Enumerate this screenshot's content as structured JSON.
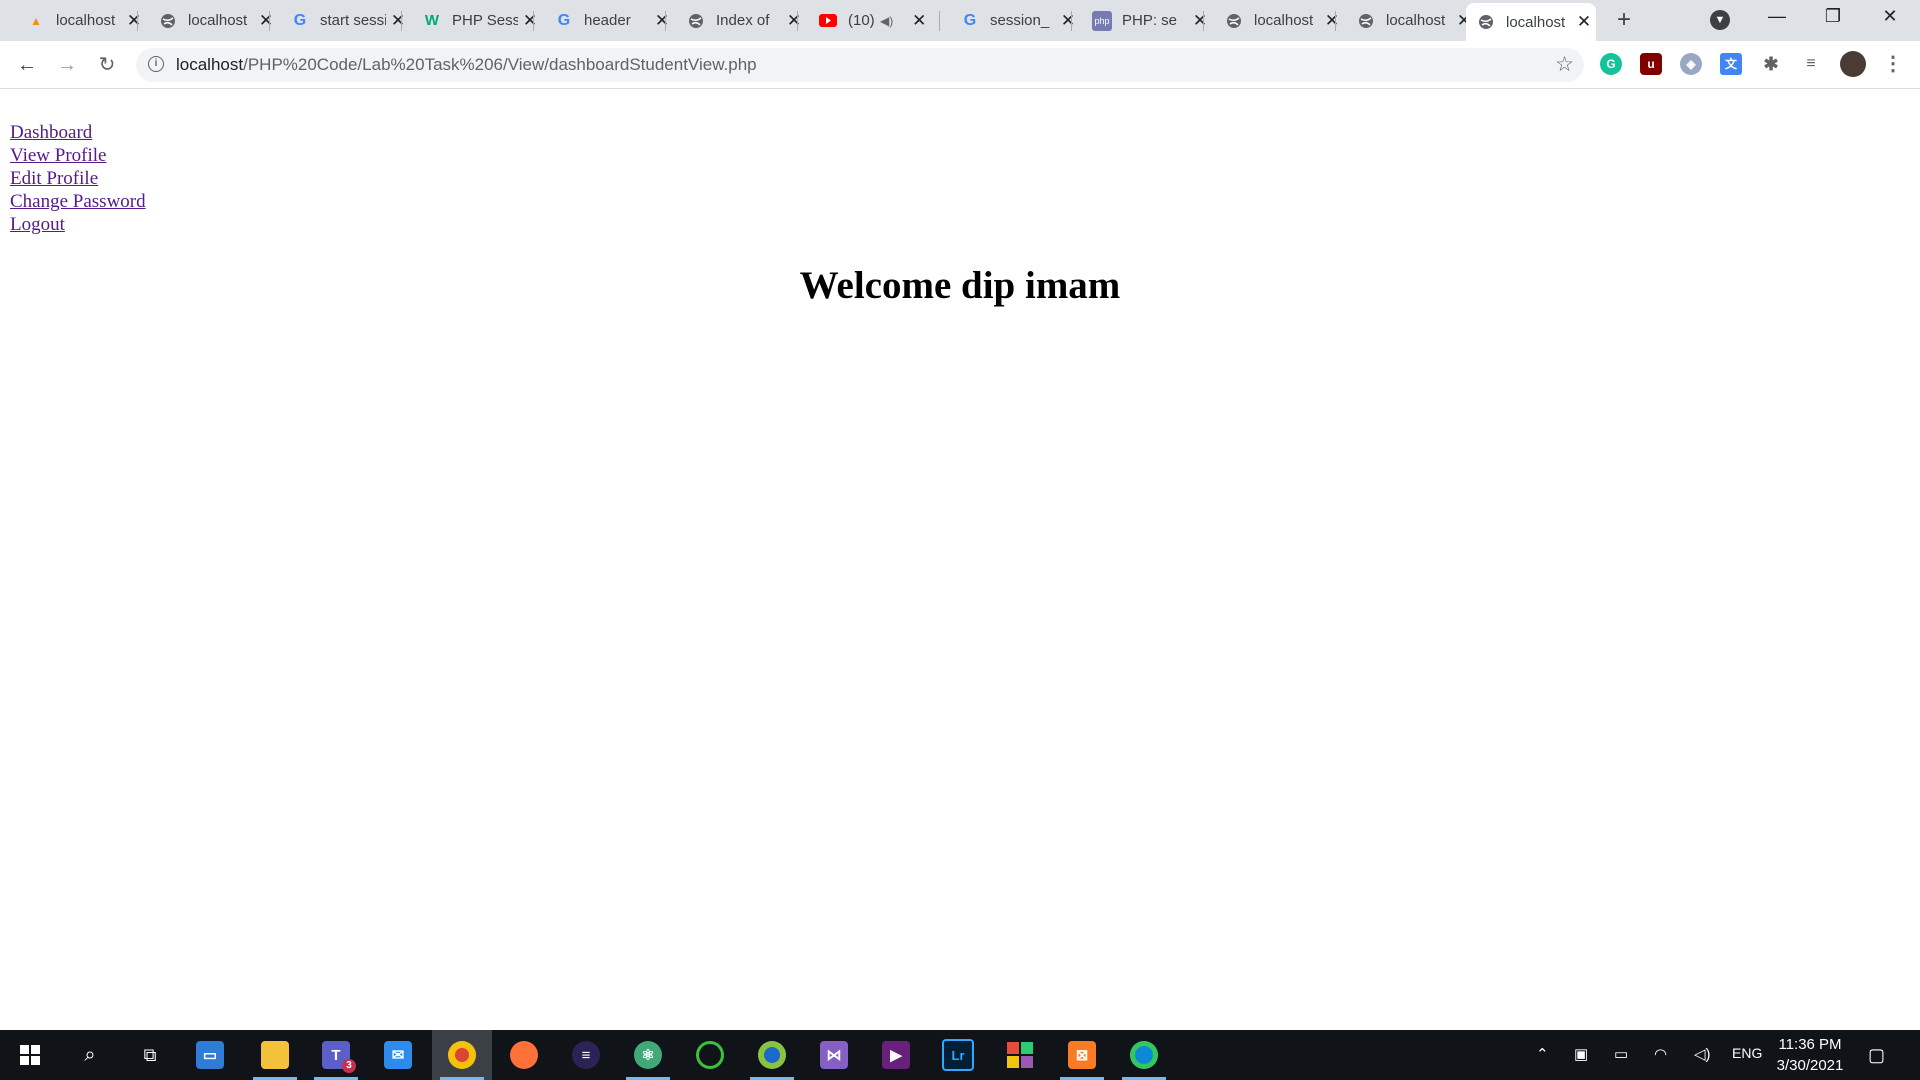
{
  "browser": {
    "tabs": [
      {
        "title": "localhost",
        "icon": "phpmyadmin-icon"
      },
      {
        "title": "localhost",
        "icon": "globe-icon"
      },
      {
        "title": "start session",
        "icon": "google-icon"
      },
      {
        "title": "PHP Session",
        "icon": "w3schools-icon"
      },
      {
        "title": "header",
        "icon": "google-icon"
      },
      {
        "title": "Index of",
        "icon": "globe-icon"
      },
      {
        "title": "(10)",
        "icon": "youtube-icon"
      },
      {
        "title": "session_",
        "icon": "google-icon"
      },
      {
        "title": "PHP: se",
        "icon": "php-icon"
      },
      {
        "title": "localhost",
        "icon": "globe-icon"
      },
      {
        "title": "localhost",
        "icon": "globe-icon"
      },
      {
        "title": "localhost",
        "icon": "globe-icon"
      }
    ],
    "url_host": "localhost",
    "url_path": "/PHP%20Code/Lab%20Task%206/View/dashboardStudentView.php"
  },
  "page": {
    "nav_links": [
      "Dashboard",
      "View Profile",
      "Edit Profile",
      "Change Password",
      "Logout"
    ],
    "welcome": "Welcome dip imam"
  },
  "taskbar": {
    "teams_badge": "3",
    "lightroom_label": "Lr",
    "language": "ENG",
    "time": "11:36 PM",
    "date": "3/30/2021"
  },
  "colors": {
    "link": "#551a8b",
    "tabstrip": "#dee1e6",
    "taskbar": "#101418"
  }
}
